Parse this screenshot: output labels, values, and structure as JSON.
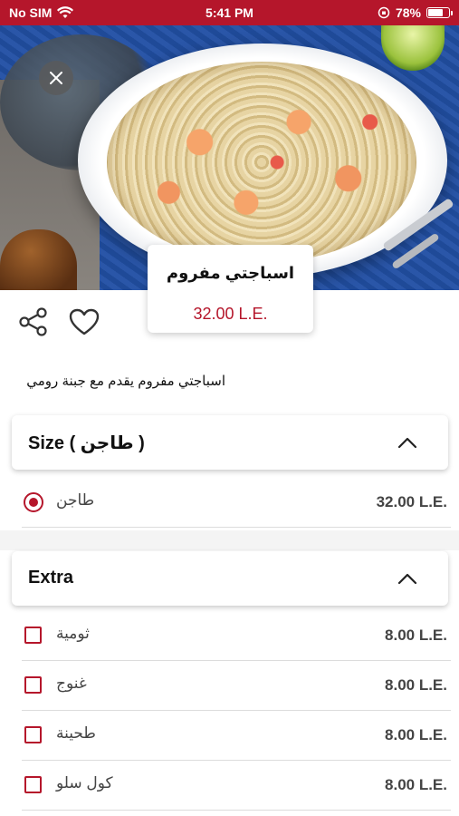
{
  "status_bar": {
    "carrier": "No SIM",
    "time": "5:41 PM",
    "battery": "78%",
    "battery_level": 0.78
  },
  "product": {
    "name": "اسباجتي مفروم",
    "price": "32.00 L.E.",
    "description": "اسباجتي مفروم يقدم مع جبنة رومي"
  },
  "icons": {
    "close": "close-icon",
    "share": "share-icon",
    "favorite": "heart-icon",
    "collapse": "chevron-up-icon"
  },
  "sections": {
    "size": {
      "title": "Size ( طاجن )",
      "options": [
        {
          "label": "طاجن",
          "price": "32.00 L.E.",
          "selected": true
        }
      ]
    },
    "extra": {
      "title": "Extra",
      "options": [
        {
          "label": "ثومية",
          "price": "8.00 L.E.",
          "checked": false
        },
        {
          "label": "غنوج",
          "price": "8.00 L.E.",
          "checked": false
        },
        {
          "label": "طحينة",
          "price": "8.00 L.E.",
          "checked": false
        },
        {
          "label": "كول سلو",
          "price": "8.00 L.E.",
          "checked": false
        }
      ]
    }
  },
  "colors": {
    "accent": "#b5162b"
  }
}
